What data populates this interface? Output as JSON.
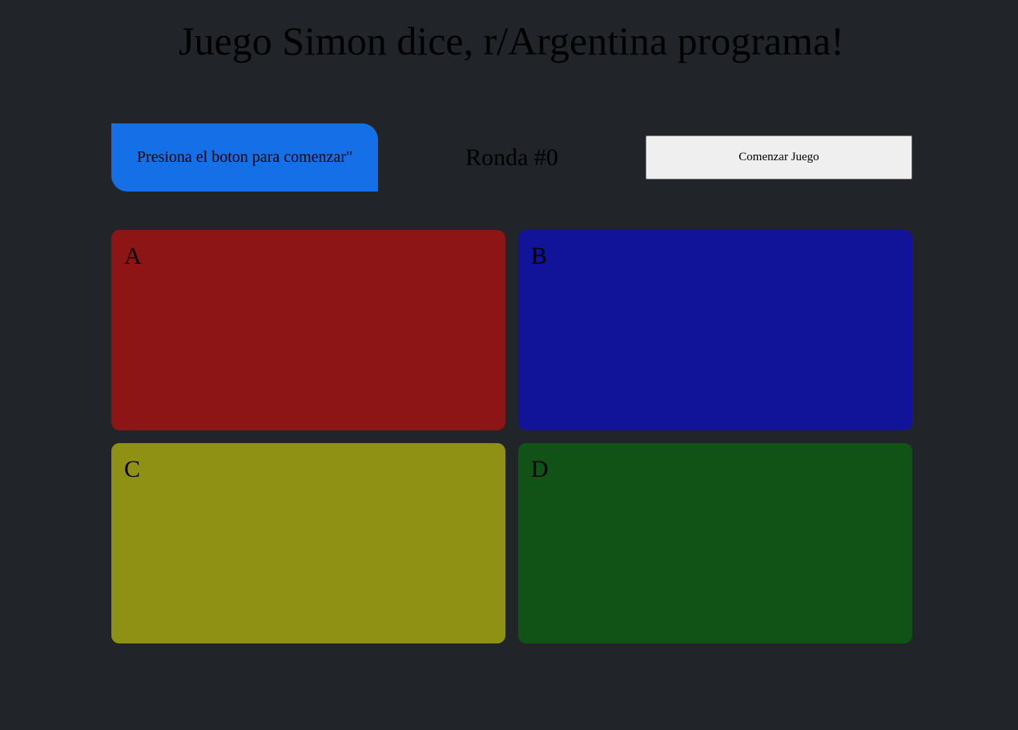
{
  "header": {
    "title": "Juego Simon dice, r/Argentina programa!"
  },
  "controls": {
    "status_message": "Presiona el boton para comenzar\"",
    "round_label": "Ronda #0",
    "start_button_label": "Comenzar Juego"
  },
  "colors": {
    "background": "#212529",
    "status_box": "#1570e8",
    "button_bg": "#efefef"
  },
  "pads": [
    {
      "id": "a",
      "letter": "A",
      "color": "#8e1515"
    },
    {
      "id": "b",
      "letter": "B",
      "color": "#111399"
    },
    {
      "id": "c",
      "letter": "C",
      "color": "#8f9114"
    },
    {
      "id": "d",
      "letter": "D",
      "color": "#115316"
    }
  ]
}
